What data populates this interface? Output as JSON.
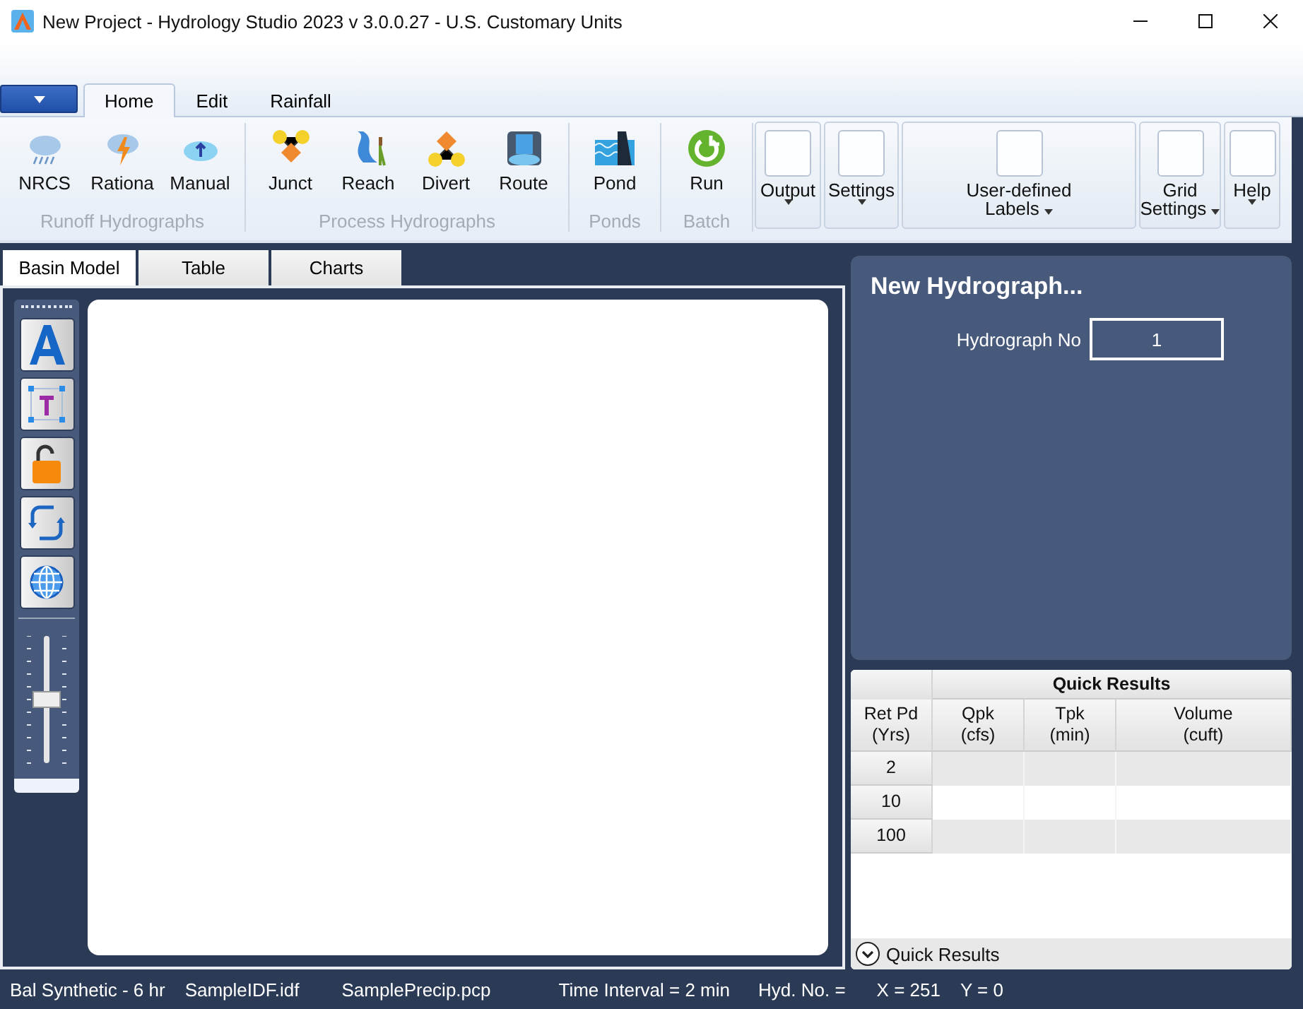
{
  "window": {
    "title": "New Project - Hydrology Studio 2023 v 3.0.0.27 - U.S. Customary Units"
  },
  "ribbon": {
    "tabs": [
      {
        "label": "Home",
        "selected": true
      },
      {
        "label": "Edit",
        "selected": false
      },
      {
        "label": "Rainfall",
        "selected": false
      }
    ],
    "groups": [
      {
        "label": "Runoff Hydrographs",
        "buttons": [
          "NRCS",
          "Rationa",
          "Manual"
        ]
      },
      {
        "label": "Process Hydrographs",
        "buttons": [
          "Junct",
          "Reach",
          "Divert",
          "Route"
        ]
      },
      {
        "label": "Ponds",
        "buttons": [
          "Pond"
        ]
      },
      {
        "label": "Batch",
        "buttons": [
          "Run"
        ]
      }
    ],
    "menus": [
      {
        "label": "Output",
        "kind": "stacked"
      },
      {
        "label": "Settings",
        "kind": "stacked"
      },
      {
        "label": "User-defined\nLabels",
        "kind": "inline"
      },
      {
        "label": "Grid\nSettings",
        "kind": "inline"
      },
      {
        "label": "Help",
        "kind": "stacked"
      }
    ]
  },
  "doc_tabs": [
    {
      "label": "Basin Model",
      "selected": true
    },
    {
      "label": "Table",
      "selected": false
    },
    {
      "label": "Charts",
      "selected": false
    }
  ],
  "zoom_slider": {
    "level": 0.5
  },
  "hydrograph_panel": {
    "title": "New Hydrograph...",
    "field_label": "Hydrograph No",
    "field_value": "1"
  },
  "quick_results": {
    "title": "Quick Results",
    "columns": [
      "Ret Pd\n(Yrs)",
      "Qpk\n(cfs)",
      "Tpk\n(min)",
      "Volume\n(cuft)"
    ],
    "rows": [
      [
        "2",
        "",
        "",
        ""
      ],
      [
        "10",
        "",
        "",
        ""
      ],
      [
        "100",
        "",
        "",
        ""
      ]
    ],
    "footer": "Quick Results"
  },
  "status_bar": [
    "Bal Synthetic - 6 hr",
    "SampleIDF.idf",
    "SamplePrecip.pcp",
    "Time Interval = 2 min",
    "Hyd. No. =",
    "X = 251",
    "Y = 0"
  ]
}
